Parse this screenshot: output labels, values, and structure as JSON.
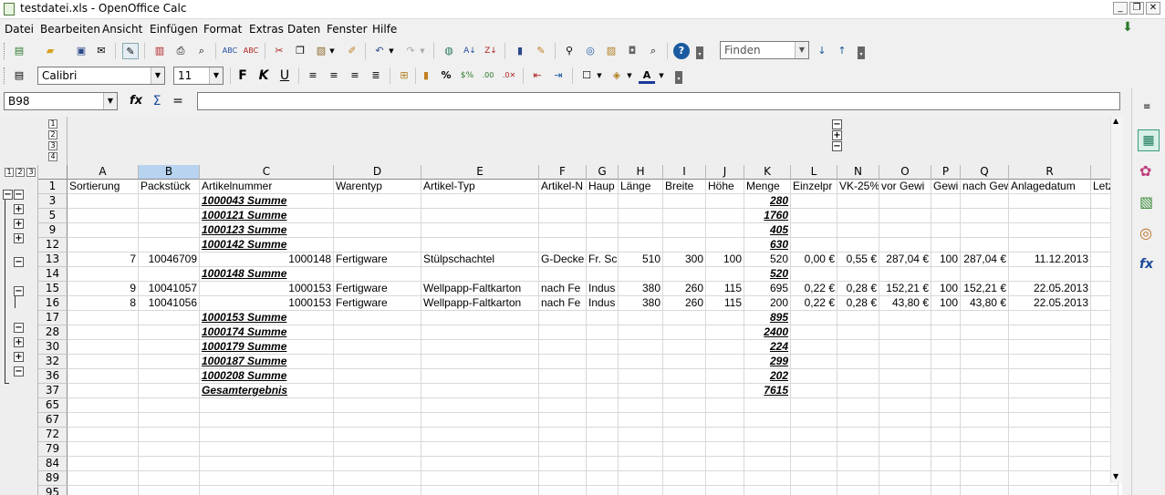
{
  "window": {
    "title": "testdatei.xls - OpenOffice Calc",
    "buttons": [
      "_",
      "❐",
      "✕"
    ]
  },
  "menu": [
    "Datei",
    "Bearbeiten",
    "Ansicht",
    "Einfügen",
    "Format",
    "Extras",
    "Daten",
    "Fenster",
    "Hilfe"
  ],
  "toolbar": {
    "find_placeholder": "Finden"
  },
  "format": {
    "font_name": "Calibri",
    "font_size": "11"
  },
  "formula": {
    "cell_ref": "B98",
    "content": "",
    "fx": "fx",
    "sum": "Σ",
    "equals": "="
  },
  "outline": {
    "levels": [
      "1",
      "2",
      "3"
    ],
    "col_levels": [
      "1",
      "2",
      "3",
      "4"
    ]
  },
  "columns": [
    {
      "label": "A",
      "w": 78
    },
    {
      "label": "B",
      "w": 67
    },
    {
      "label": "C",
      "w": 147
    },
    {
      "label": "D",
      "w": 96
    },
    {
      "label": "E",
      "w": 129
    },
    {
      "label": "F",
      "w": 52
    },
    {
      "label": "G",
      "w": 35
    },
    {
      "label": "H",
      "w": 49
    },
    {
      "label": "I",
      "w": 47
    },
    {
      "label": "J",
      "w": 42
    },
    {
      "label": "K",
      "w": 51
    },
    {
      "label": "L",
      "w": 51
    },
    {
      "label": "N",
      "w": 46
    },
    {
      "label": "O",
      "w": 57
    },
    {
      "label": "P",
      "w": 32
    },
    {
      "label": "Q",
      "w": 53
    },
    {
      "label": "R",
      "w": 90
    },
    {
      "label": "",
      "w": 30
    }
  ],
  "header_row": [
    "Sortierung",
    "Packstück",
    "Artikelnummer",
    "Warentyp",
    "Artikel-Typ",
    "Artikel-N",
    "Haup",
    "Länge",
    "Breite",
    "Höhe",
    "Menge",
    "Einzelpr",
    "VK-25%",
    "vor Gewi",
    "Gewi",
    "nach Gew",
    "Anlagedatum",
    "Letz"
  ],
  "rows": [
    {
      "n": "1",
      "kind": "header"
    },
    {
      "n": "3",
      "kind": "sum",
      "label": "1000043 Summe",
      "menge": "280"
    },
    {
      "n": "5",
      "kind": "sum",
      "label": "1000121 Summe",
      "menge": "1760"
    },
    {
      "n": "9",
      "kind": "sum",
      "label": "1000123 Summe",
      "menge": "405"
    },
    {
      "n": "12",
      "kind": "sum",
      "label": "1000142 Summe",
      "menge": "630"
    },
    {
      "n": "13",
      "kind": "data",
      "cells": [
        "7",
        "10046709",
        "1000148",
        "Fertigware",
        "Stülpschachtel",
        "G-Decke",
        "Fr. Sc",
        "510",
        "300",
        "100",
        "520",
        "0,00 €",
        "0,55 €",
        "287,04 €",
        "100",
        "287,04 €",
        "11.12.2013",
        ""
      ]
    },
    {
      "n": "14",
      "kind": "sum",
      "label": "1000148 Summe",
      "menge": "520"
    },
    {
      "n": "15",
      "kind": "data",
      "cells": [
        "9",
        "10041057",
        "1000153",
        "Fertigware",
        "Wellpapp-Faltkarton",
        "nach Fe",
        "Indus",
        "380",
        "260",
        "115",
        "695",
        "0,22 €",
        "0,28 €",
        "152,21 €",
        "100",
        "152,21 €",
        "22.05.2013",
        ""
      ]
    },
    {
      "n": "16",
      "kind": "data",
      "cells": [
        "8",
        "10041056",
        "1000153",
        "Fertigware",
        "Wellpapp-Faltkarton",
        "nach Fe",
        "Indus",
        "380",
        "260",
        "115",
        "200",
        "0,22 €",
        "0,28 €",
        "43,80 €",
        "100",
        "43,80 €",
        "22.05.2013",
        ""
      ]
    },
    {
      "n": "17",
      "kind": "sum",
      "label": "1000153 Summe",
      "menge": "895"
    },
    {
      "n": "28",
      "kind": "sum",
      "label": "1000174 Summe",
      "menge": "2400"
    },
    {
      "n": "30",
      "kind": "sum",
      "label": "1000179 Summe",
      "menge": "224"
    },
    {
      "n": "32",
      "kind": "sum",
      "label": "1000187 Summe",
      "menge": "299"
    },
    {
      "n": "36",
      "kind": "sum",
      "label": "1000208 Summe",
      "menge": "202"
    },
    {
      "n": "37",
      "kind": "sum",
      "label": "Gesamtergebnis",
      "menge": "7615"
    },
    {
      "n": "65",
      "kind": "empty"
    },
    {
      "n": "67",
      "kind": "empty"
    },
    {
      "n": "72",
      "kind": "empty"
    },
    {
      "n": "79",
      "kind": "empty"
    },
    {
      "n": "84",
      "kind": "empty"
    },
    {
      "n": "89",
      "kind": "empty"
    },
    {
      "n": "95",
      "kind": "empty"
    }
  ]
}
